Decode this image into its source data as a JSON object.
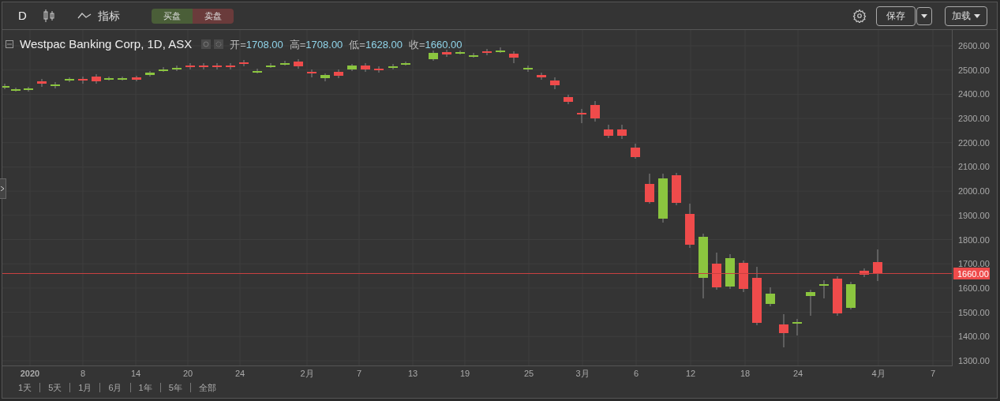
{
  "toolbar": {
    "interval": "D",
    "indicators_label": "指标",
    "buy_button": "买盘",
    "sell_button": "卖盘",
    "save_button": "保存",
    "load_button": "加载"
  },
  "legend": {
    "title": "Westpac Banking Corp, 1D, ASX",
    "ohlc": [
      {
        "label": "开=",
        "value": "1708.00"
      },
      {
        "label": "高=",
        "value": "1708.00"
      },
      {
        "label": "低=",
        "value": "1628.00"
      },
      {
        "label": "收=",
        "value": "1660.00"
      }
    ]
  },
  "price_axis": {
    "labels": [
      "2600.00",
      "2500.00",
      "2400.00",
      "2300.00",
      "2200.00",
      "2100.00",
      "2000.00",
      "1900.00",
      "1800.00",
      "1700.00",
      "1600.00",
      "1500.00",
      "1400.00",
      "1300.00"
    ],
    "current_price": "1660.00"
  },
  "time_axis": {
    "labels": [
      {
        "text": "2020",
        "kind": "year"
      },
      {
        "text": "8",
        "kind": "date"
      },
      {
        "text": "14",
        "kind": "date"
      },
      {
        "text": "20",
        "kind": "date"
      },
      {
        "text": "24",
        "kind": "date"
      },
      {
        "text": "2月",
        "kind": "date"
      },
      {
        "text": "7",
        "kind": "date"
      },
      {
        "text": "13",
        "kind": "date"
      },
      {
        "text": "19",
        "kind": "date"
      },
      {
        "text": "25",
        "kind": "date"
      },
      {
        "text": "3月",
        "kind": "date"
      },
      {
        "text": "6",
        "kind": "date"
      },
      {
        "text": "12",
        "kind": "date"
      },
      {
        "text": "18",
        "kind": "date"
      },
      {
        "text": "24",
        "kind": "date"
      },
      {
        "text": "4月",
        "kind": "date"
      },
      {
        "text": "7",
        "kind": "date"
      }
    ]
  },
  "range_buttons": [
    "1天",
    "5天",
    "1月",
    "6月",
    "1年",
    "5年",
    "全部"
  ]
}
